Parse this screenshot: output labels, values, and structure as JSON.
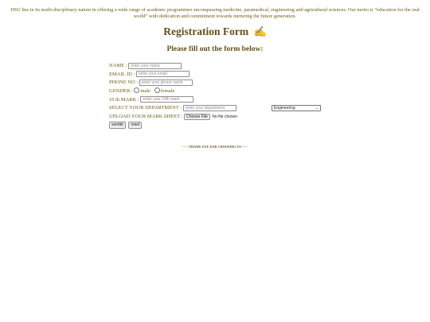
{
  "intro_text": "DSU lies in its multi-disciplinary nature in offering a wide range of academic programmes encompassing medicine, paramedical, engineering and agricultural sciences. Our motto is “education for the real world” with dedication and commitment towards nurturing the future generation.",
  "title": "Registration Form",
  "title_icon": "✍",
  "subtitle": "Please fill out the form below:",
  "form": {
    "name": {
      "label": "NAME :",
      "placeholder": "enter your name"
    },
    "email": {
      "label": "EMAIL ID :",
      "placeholder": "enter your email"
    },
    "phone": {
      "label": "PHONE NO :",
      "placeholder": "enter your phone numb"
    },
    "gender": {
      "label": "GENDER :",
      "options": [
        "male",
        "female"
      ]
    },
    "mark10": {
      "label": "10 th MARK :",
      "placeholder": "enter your 10th mark"
    },
    "department": {
      "label": "SELECT YOUR DEPARTMENT :",
      "placeholder": "enter your department",
      "selected": "Engineering"
    },
    "marksheet": {
      "label": "UPLOAD YOUR MARK SHEET :",
      "button": "Choose File",
      "status": "No file chosen"
    },
    "submit_label": "sumbit",
    "reset_label": "reset"
  },
  "footer": "------THANK YOU FOR CHOOSING US------"
}
